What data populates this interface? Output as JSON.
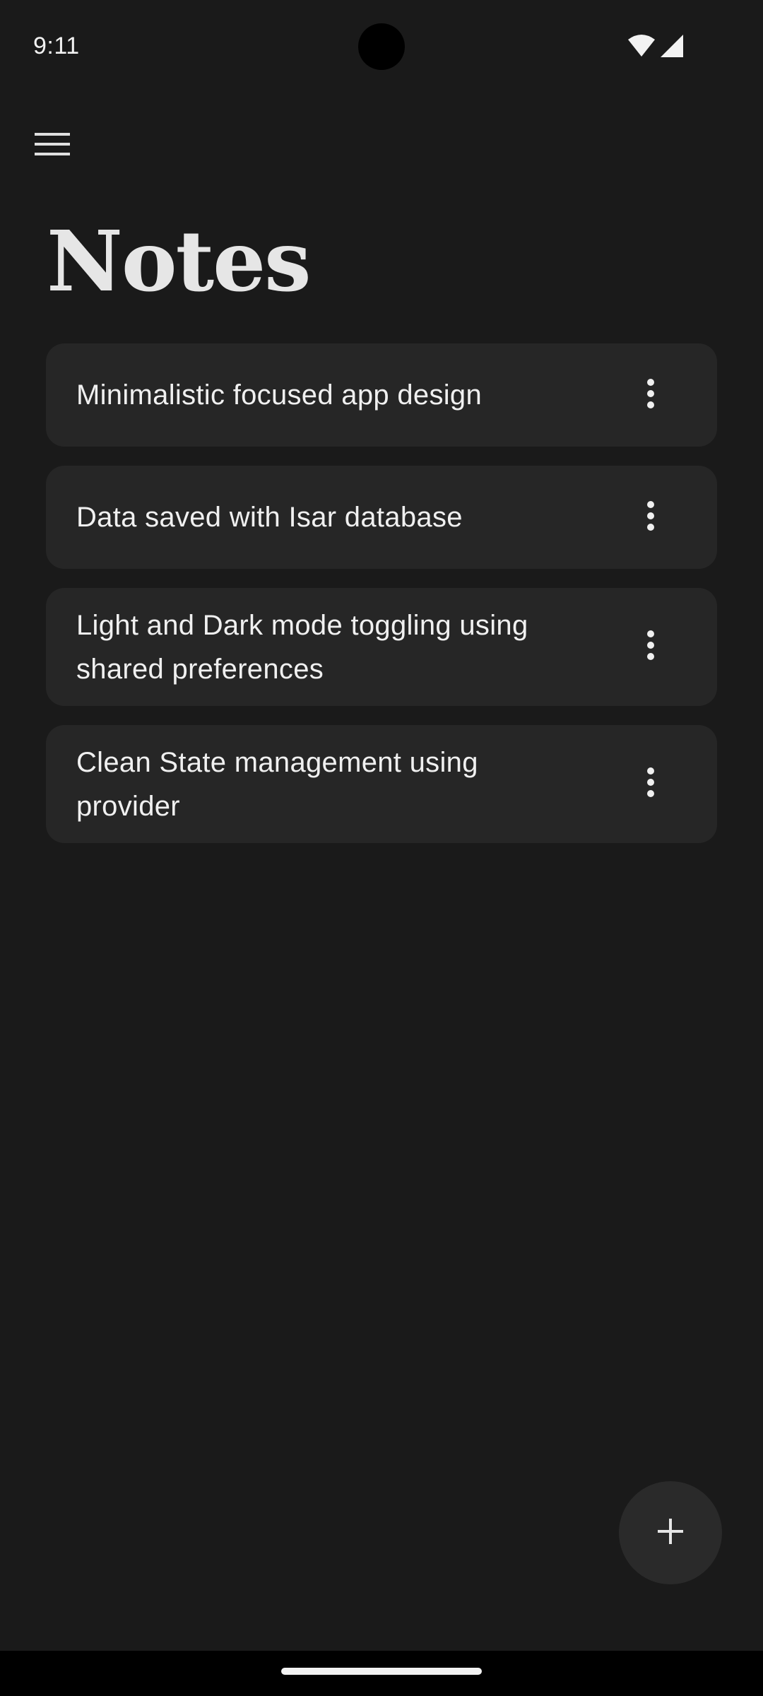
{
  "status_bar": {
    "time": "9:11",
    "icons": [
      "wifi-icon",
      "cellular-signal-icon"
    ]
  },
  "app_bar": {
    "menu_icon": "hamburger-menu-icon"
  },
  "page": {
    "title": "Notes"
  },
  "notes": [
    {
      "text": "Minimalistic focused app design",
      "more_icon": "more-vertical-icon"
    },
    {
      "text": "Data saved with Isar database",
      "more_icon": "more-vertical-icon"
    },
    {
      "text": "Light and Dark mode toggling using shared preferences",
      "more_icon": "more-vertical-icon"
    },
    {
      "text": "Clean State management using provider",
      "more_icon": "more-vertical-icon"
    }
  ],
  "fab": {
    "icon": "plus-icon"
  },
  "colors": {
    "background": "#1a1a1a",
    "card": "#262626",
    "fab": "#2a2a2a",
    "text": "#f0f0f0",
    "title": "#e6e6e6"
  }
}
